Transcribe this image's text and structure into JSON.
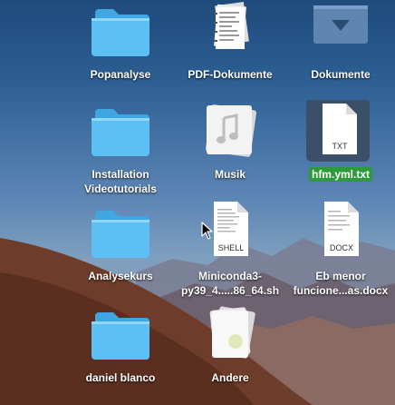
{
  "desktop": {
    "items": [
      {
        "label": "Popanalyse",
        "icon": "folder-icon"
      },
      {
        "label": "PDF-Dokumente",
        "icon": "pdf-stack-icon"
      },
      {
        "label": "Dokumente",
        "icon": "documents-folder-icon"
      },
      {
        "label": "Installation\nVideotutorials",
        "icon": "folder-icon"
      },
      {
        "label": "Musik",
        "icon": "music-document-icon"
      },
      {
        "label": "hfm.yml.txt",
        "icon": "txt-file-icon",
        "badge": "TXT",
        "selected": true
      },
      {
        "label": "Analysekurs",
        "icon": "folder-icon"
      },
      {
        "label": "Miniconda3-\npy39_4.....86_64.sh",
        "icon": "shell-file-icon",
        "badge": "SHELL"
      },
      {
        "label": "Eb menor\nfuncione...as.docx",
        "icon": "docx-file-icon",
        "badge": "DOCX"
      },
      {
        "label": "daniel blanco",
        "icon": "folder-icon"
      },
      {
        "label": "Andere",
        "icon": "document-stack-icon"
      }
    ]
  },
  "colors": {
    "folder": "#5cc0f5",
    "selection": "#2e9b3a",
    "selected_icon_bg": "#3b4f69"
  }
}
